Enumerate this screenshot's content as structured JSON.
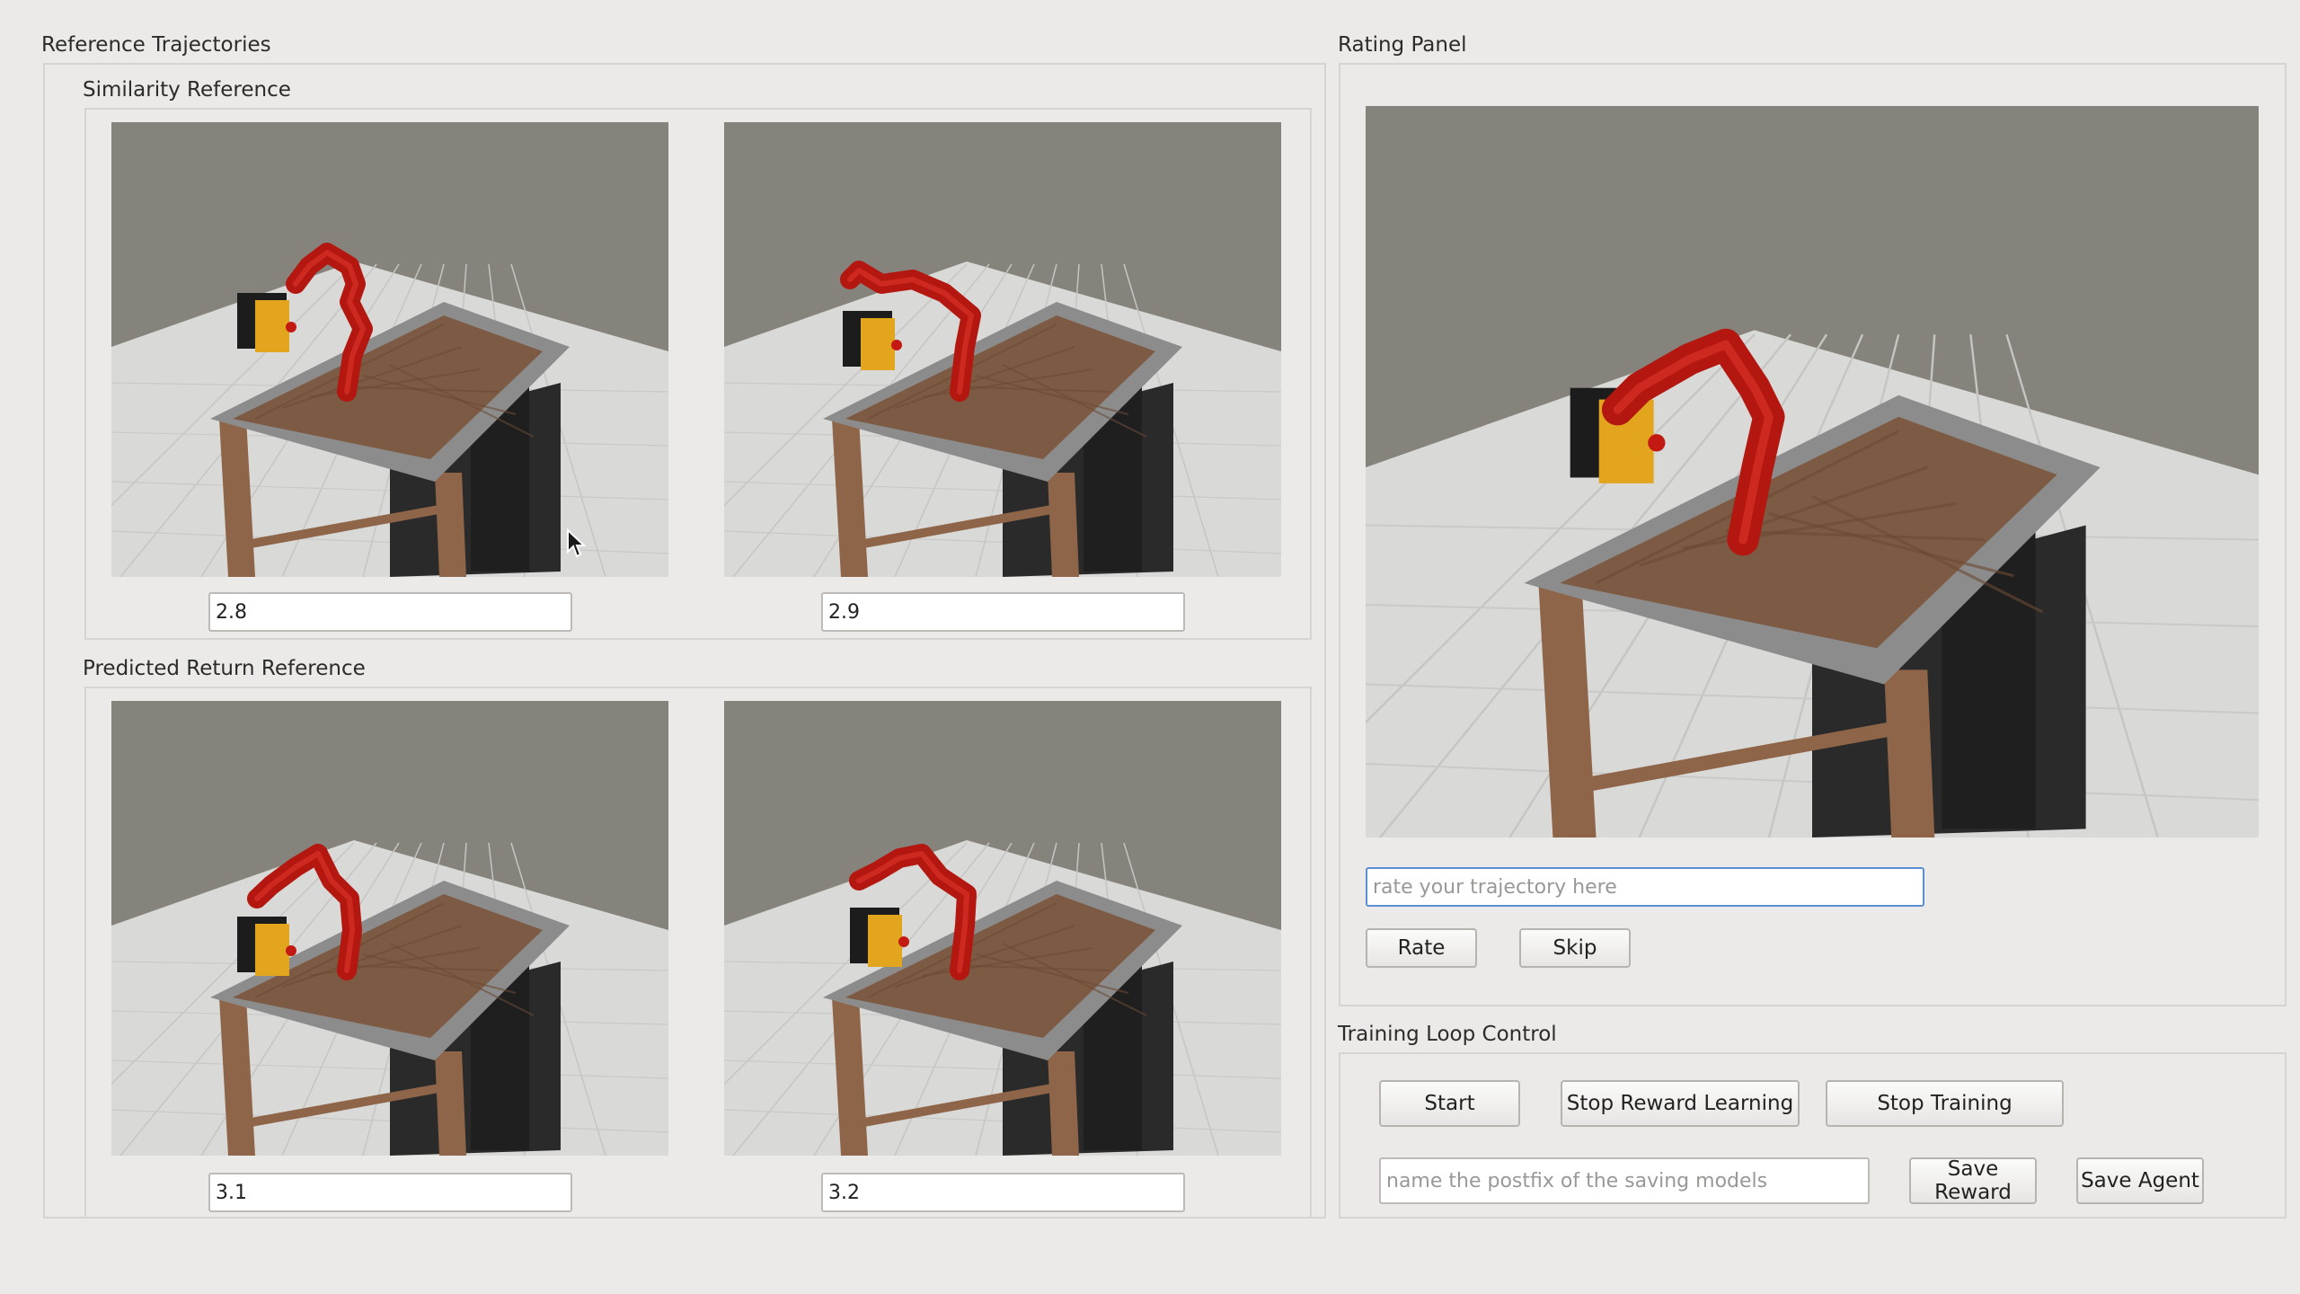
{
  "reference": {
    "title": "Reference Trajectories",
    "similarity": {
      "title": "Similarity Reference",
      "values": [
        "2.8",
        "2.9"
      ]
    },
    "predicted": {
      "title": "Predicted Return Reference",
      "values": [
        "3.1",
        "3.2"
      ]
    }
  },
  "rating": {
    "title": "Rating Panel",
    "input_placeholder": "rate your trajectory here",
    "rate_label": "Rate",
    "skip_label": "Skip"
  },
  "training": {
    "title": "Training Loop Control",
    "start_label": "Start",
    "stop_reward_label": "Stop Reward Learning",
    "stop_training_label": "Stop Training",
    "postfix_placeholder": "name the postfix of the saving models",
    "save_reward_label": "Save Reward",
    "save_agent_label": "Save Agent"
  },
  "scene_colors": {
    "sky": "#85837b",
    "floor": "#d9d9d7",
    "table_top": "#7d5a43",
    "table_rim": "#8c8c8c",
    "table_leg": "#8e6549",
    "robot": "#b3170f",
    "robot_base": "#2a2a2a",
    "box_yellow": "#e3a51e",
    "box_black": "#1c1c1c"
  },
  "icons": [
    "mouse-cursor-icon"
  ]
}
